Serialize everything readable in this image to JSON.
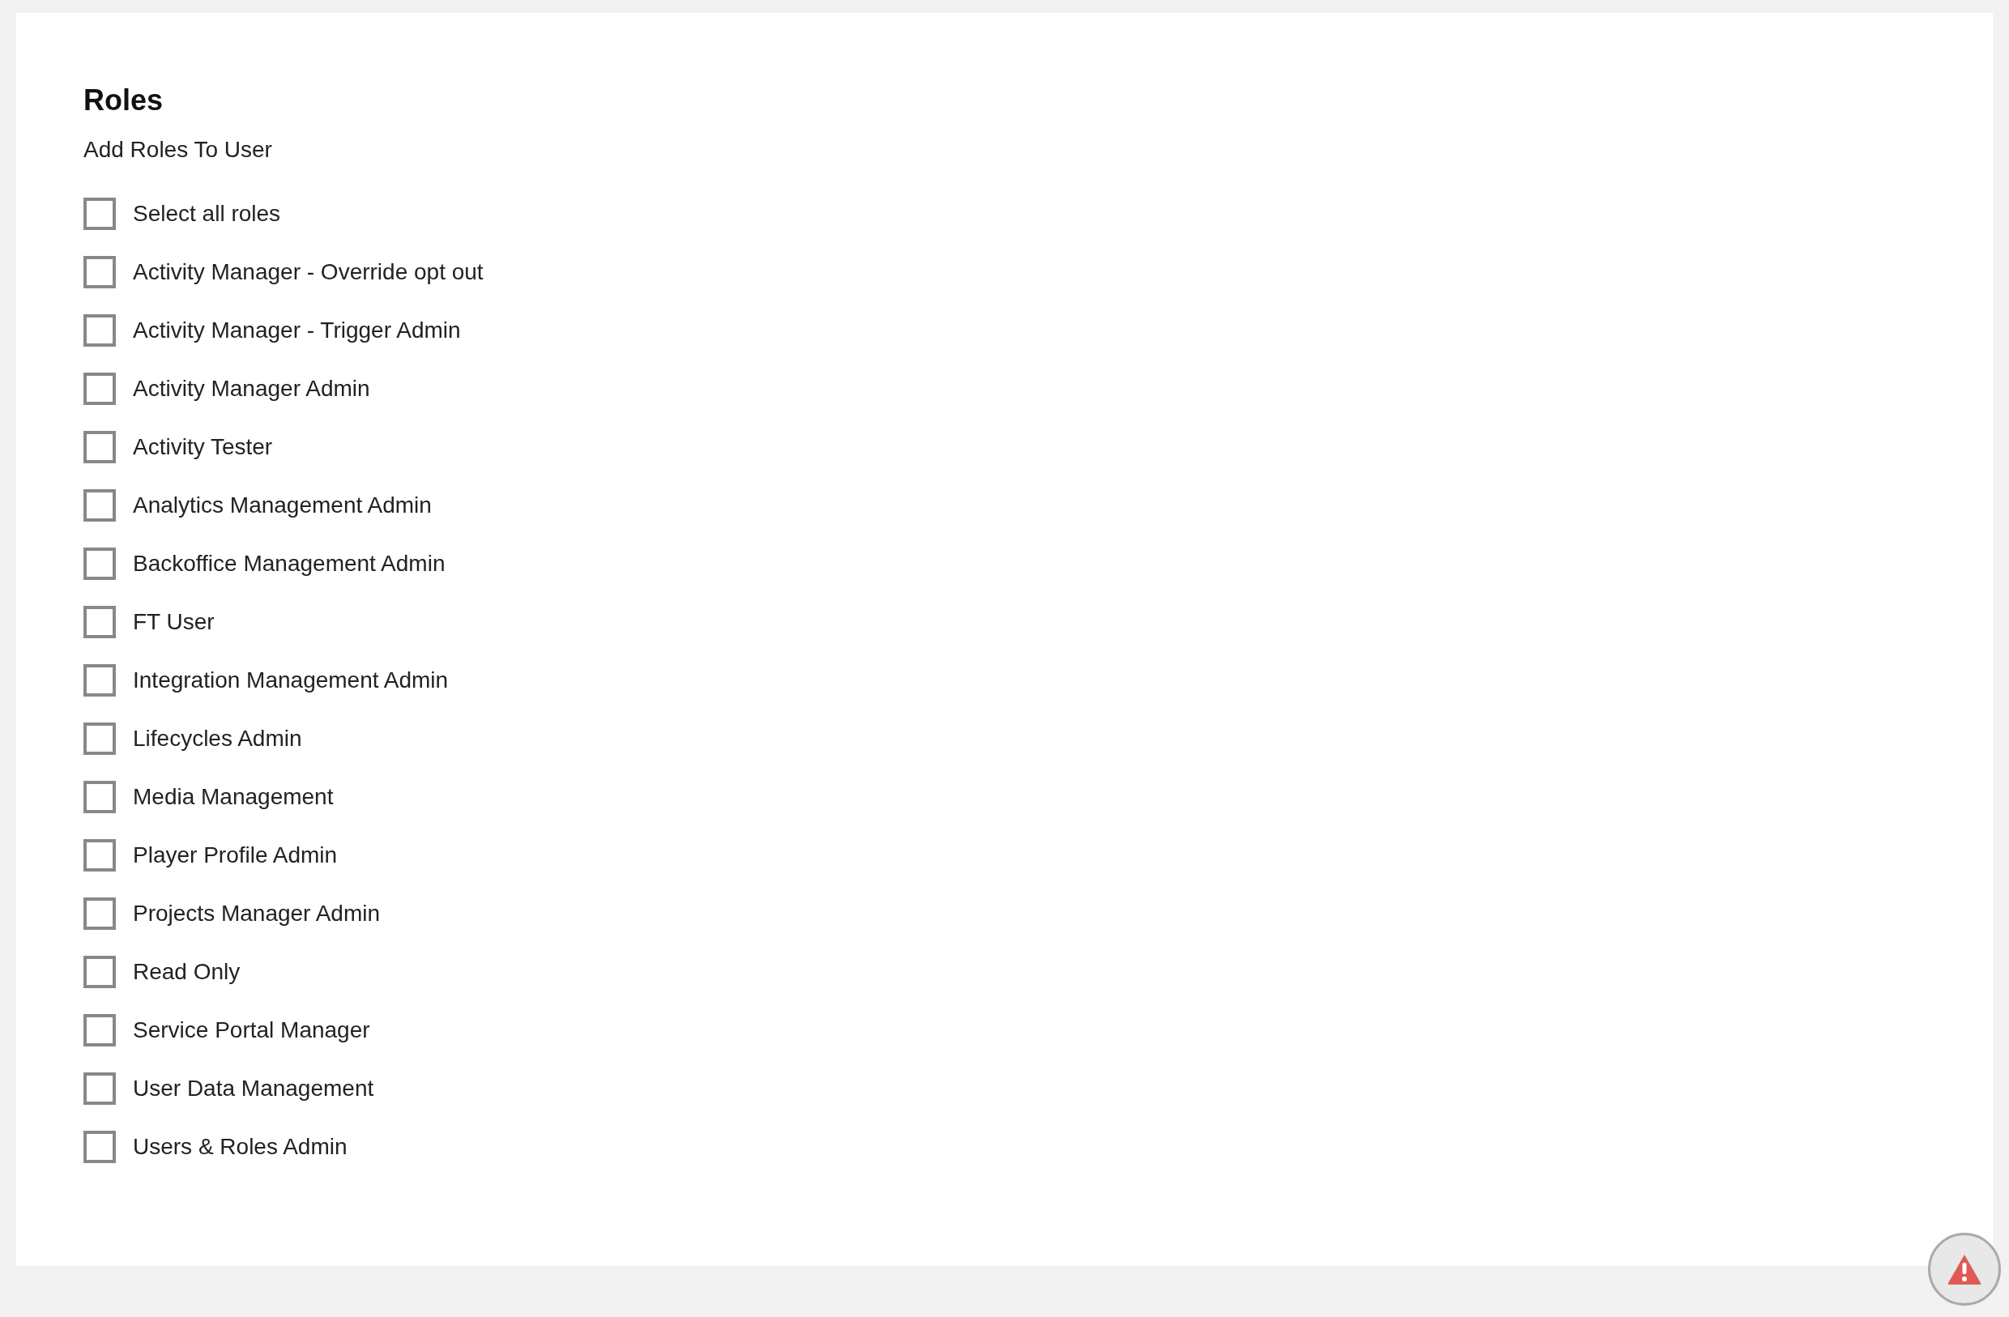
{
  "title": "Roles",
  "subtitle": "Add Roles To User",
  "roles": [
    {
      "label": "Select all roles",
      "checked": false
    },
    {
      "label": "Activity Manager - Override opt out",
      "checked": false
    },
    {
      "label": "Activity Manager - Trigger Admin",
      "checked": false
    },
    {
      "label": "Activity Manager Admin",
      "checked": false
    },
    {
      "label": "Activity Tester",
      "checked": false
    },
    {
      "label": "Analytics Management Admin",
      "checked": false
    },
    {
      "label": "Backoffice Management Admin",
      "checked": false
    },
    {
      "label": "FT User",
      "checked": false
    },
    {
      "label": "Integration Management Admin",
      "checked": false
    },
    {
      "label": "Lifecycles Admin",
      "checked": false
    },
    {
      "label": "Media Management",
      "checked": false
    },
    {
      "label": "Player Profile Admin",
      "checked": false
    },
    {
      "label": "Projects Manager Admin",
      "checked": false
    },
    {
      "label": "Read Only",
      "checked": false
    },
    {
      "label": "Service Portal Manager",
      "checked": false
    },
    {
      "label": "User Data Management",
      "checked": false
    },
    {
      "label": "Users & Roles Admin",
      "checked": false
    }
  ]
}
